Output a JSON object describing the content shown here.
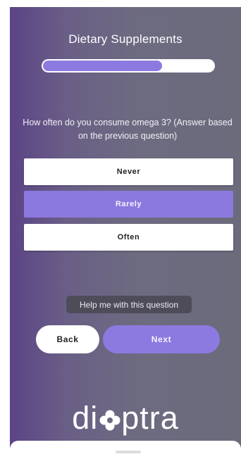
{
  "header": {
    "title": "Dietary Supplements"
  },
  "progress": {
    "value": 0.7
  },
  "question": {
    "text": "How often do you consume omega 3? (Answer based on the previous question)"
  },
  "options": [
    {
      "label": "Never",
      "selected": false
    },
    {
      "label": "Rarely",
      "selected": true
    },
    {
      "label": "Often",
      "selected": false
    }
  ],
  "help": {
    "label": "Help me with this question"
  },
  "nav": {
    "back_label": "Back",
    "next_label": "Next"
  },
  "brand": {
    "logo_text_left": "di",
    "logo_text_right": "ptra",
    "logo_icon": "flower-icon"
  },
  "colors": {
    "accent": "#8d7ae0",
    "background_start": "#5b4486",
    "background_end": "#6b6b7c",
    "help_bg": "#4f4c5a"
  }
}
